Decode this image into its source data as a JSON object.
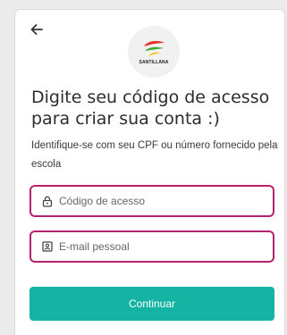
{
  "logo": {
    "text": "SANTILLANA"
  },
  "heading": {
    "title": "Digite seu código de acesso para criar sua conta :)"
  },
  "instructions": {
    "text": "Identifique-se com seu CPF ou número fornecido pela escola"
  },
  "form": {
    "access_code_placeholder": "Código de acesso",
    "email_placeholder": "E-mail pessoal",
    "continue_label": "Continuar"
  },
  "icons": {
    "back": "arrow-left-icon",
    "access_code": "lock-icon",
    "email": "id-card-icon"
  },
  "colors": {
    "accent": "#15b3a3",
    "field_border": "#b5226e",
    "logo_red": "#e6332a",
    "logo_green": "#3aa935",
    "logo_yellow": "#f5c400"
  }
}
